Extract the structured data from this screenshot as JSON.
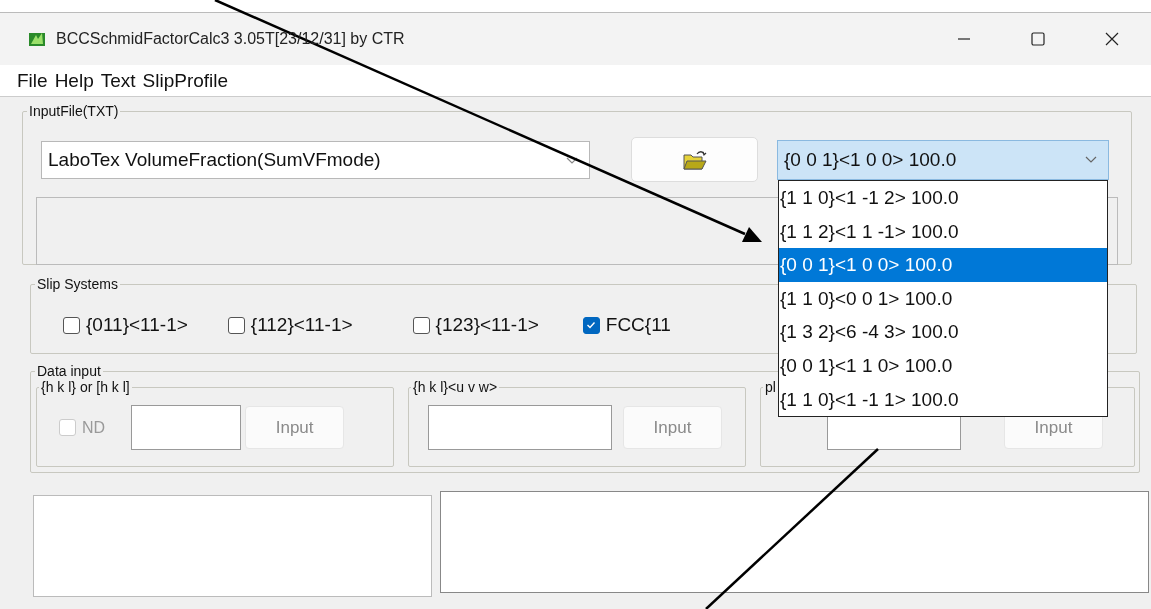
{
  "window": {
    "title": "BCCSchmidFactorCalc3 3.05T[23/12/31] by CTR"
  },
  "menu": [
    "File",
    "Help",
    "Text",
    "SlipProfile"
  ],
  "input_file": {
    "title": "InputFile(TXT)",
    "file_type": "LaboTex VolumeFraction(SumVFmode)",
    "slip_profile": {
      "value": "{0 0 1}<1 0 0> 100.0",
      "expanded": true,
      "options": [
        {
          "label": "{1 1 0}<1 -1 2> 100.0",
          "selected": false
        },
        {
          "label": "{1 1 2}<1 1 -1> 100.0",
          "selected": false
        },
        {
          "label": "{0 0 1}<1 0 0> 100.0",
          "selected": true
        },
        {
          "label": "{1 1 0}<0 0 1> 100.0",
          "selected": false
        },
        {
          "label": "{1 3 2}<6 -4 3> 100.0",
          "selected": false
        },
        {
          "label": "{0 0 1}<1 1 0> 100.0",
          "selected": false
        },
        {
          "label": "{1 1 0}<1 -1 1> 100.0",
          "selected": false
        }
      ]
    }
  },
  "slip_systems": {
    "title": "Slip Systems",
    "items": [
      {
        "label": "{011}<11-1>",
        "checked": false
      },
      {
        "label": "{112}<11-1>",
        "checked": false
      },
      {
        "label": "{123}<11-1>",
        "checked": false
      },
      {
        "label": "FCC{11",
        "checked": true
      }
    ]
  },
  "data_input": {
    "title": "Data input",
    "groups": [
      {
        "title": "{h k l} or [h k l]",
        "nd": {
          "label": "ND",
          "checked": false,
          "disabled": true
        },
        "button": {
          "label": "Input",
          "disabled": true
        }
      },
      {
        "title": "{h k l}<u v w>",
        "button": {
          "label": "Input",
          "disabled": true
        }
      },
      {
        "title": "pl",
        "button": {
          "label": "Input",
          "disabled": true
        }
      }
    ]
  }
}
